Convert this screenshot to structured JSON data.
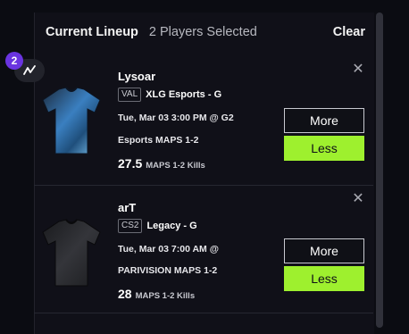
{
  "header": {
    "title": "Current Lineup",
    "subtitle": "2 Players Selected",
    "clear_label": "Clear"
  },
  "badge": {
    "count": "2",
    "icon": "trend-icon"
  },
  "players": [
    {
      "name": "Lysoar",
      "game": "VAL",
      "team": "XLG Esports - G",
      "date": "Tue, Mar 03 3:00 PM @ G2",
      "opponent": "Esports MAPS 1-2",
      "projection": "27.5",
      "stat": "MAPS 1-2 Kills",
      "more_label": "More",
      "less_label": "Less",
      "jersey_color": "#3a7fc0"
    },
    {
      "name": "arT",
      "game": "CS2",
      "team": "Legacy - G",
      "date": "Tue, Mar 03 7:00 AM @",
      "opponent": "PARIVISION MAPS 1-2",
      "projection": "28",
      "stat": "MAPS 1-2 Kills",
      "more_label": "More",
      "less_label": "Less",
      "jersey_color": "#2a2b2e"
    }
  ],
  "colors": {
    "accent": "#9ef02e",
    "badge": "#6a34e0",
    "background": "#101018"
  }
}
